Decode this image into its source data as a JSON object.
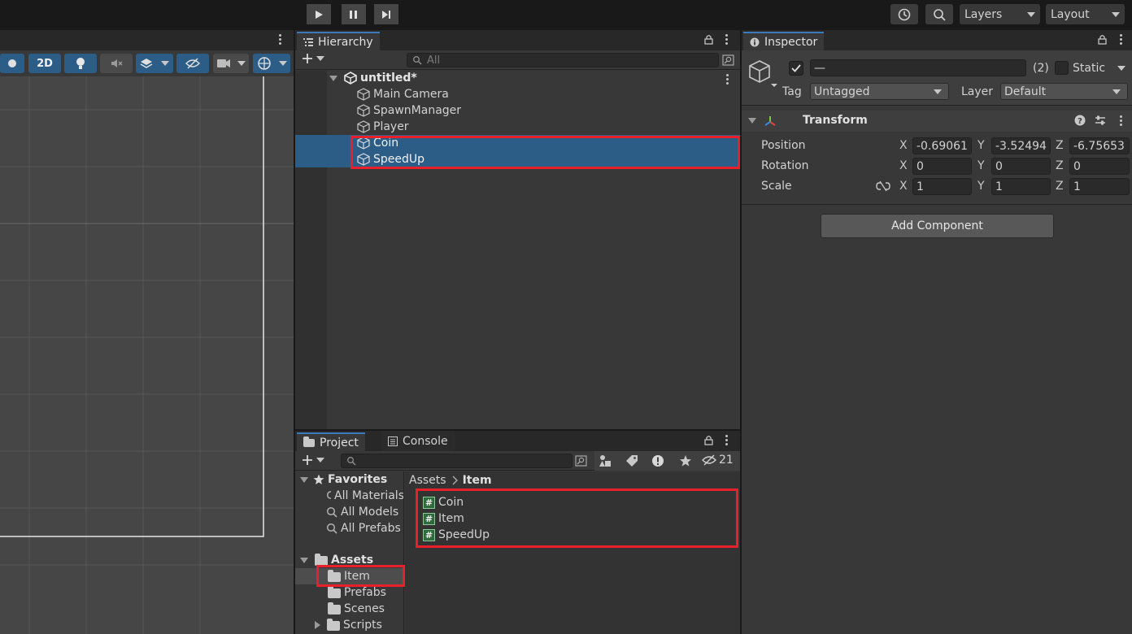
{
  "toolbar": {
    "layers_label": "Layers",
    "layout_label": "Layout"
  },
  "scene": {
    "mode_2d_label": "2D"
  },
  "hierarchy": {
    "tab_label": "Hierarchy",
    "search_placeholder": "All",
    "scene_name": "untitled*",
    "items": [
      "Main Camera",
      "SpawnManager",
      "Player",
      "Coin",
      "SpeedUp"
    ]
  },
  "inspector": {
    "tab_label": "Inspector",
    "object_name": "—",
    "selection_count": "(2)",
    "static_label": "Static",
    "tag_label": "Tag",
    "tag_value": "Untagged",
    "layer_label": "Layer",
    "layer_value": "Default",
    "component_title": "Transform",
    "rows": [
      {
        "label": "Position",
        "x": "-0.69061",
        "y": "-3.52494",
        "z": "-6.75653"
      },
      {
        "label": "Rotation",
        "x": "0",
        "y": "0",
        "z": "0"
      },
      {
        "label": "Scale",
        "x": "1",
        "y": "1",
        "z": "1"
      }
    ],
    "axis_x": "X",
    "axis_y": "Y",
    "axis_z": "Z",
    "add_component_label": "Add Component"
  },
  "project": {
    "tab_label": "Project",
    "console_tab_label": "Console",
    "hidden_count": "21",
    "favorites_label": "Favorites",
    "favorites": [
      "All Materials",
      "All Models",
      "All Prefabs"
    ],
    "assets_label": "Assets",
    "asset_folders": [
      "Item",
      "Prefabs",
      "Scenes",
      "Scripts"
    ],
    "breadcrumb_root": "Assets",
    "breadcrumb_current": "Item",
    "files": [
      "Coin",
      "Item",
      "SpeedUp"
    ]
  },
  "colors": {
    "selection": "#2c5d87",
    "annotation_red": "#e8202a",
    "panel_bg": "#383838",
    "tab_accent": "#3a79bb"
  }
}
